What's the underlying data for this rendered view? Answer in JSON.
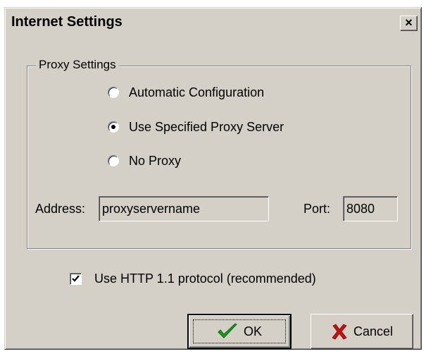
{
  "window": {
    "title": "Internet Settings",
    "close_label": "×"
  },
  "proxy_group": {
    "legend": "Proxy Settings",
    "options": [
      {
        "label": "Automatic Configuration",
        "selected": false
      },
      {
        "label": "Use Specified Proxy Server",
        "selected": true
      },
      {
        "label": "No Proxy",
        "selected": false
      }
    ],
    "address_label": "Address:",
    "address_value": "proxyservername",
    "port_label": "Port:",
    "port_value": "8080"
  },
  "http11": {
    "label": "Use HTTP 1.1 protocol (recommended)",
    "checked": true
  },
  "buttons": {
    "ok_label": "OK",
    "cancel_label": "Cancel",
    "ok_icon": "green-checkmark-icon",
    "cancel_icon": "red-x-icon"
  },
  "colors": {
    "dialog_face": "#d4d0c8",
    "ok_check": "#1a9a1a",
    "cancel_x": "#c81010"
  }
}
